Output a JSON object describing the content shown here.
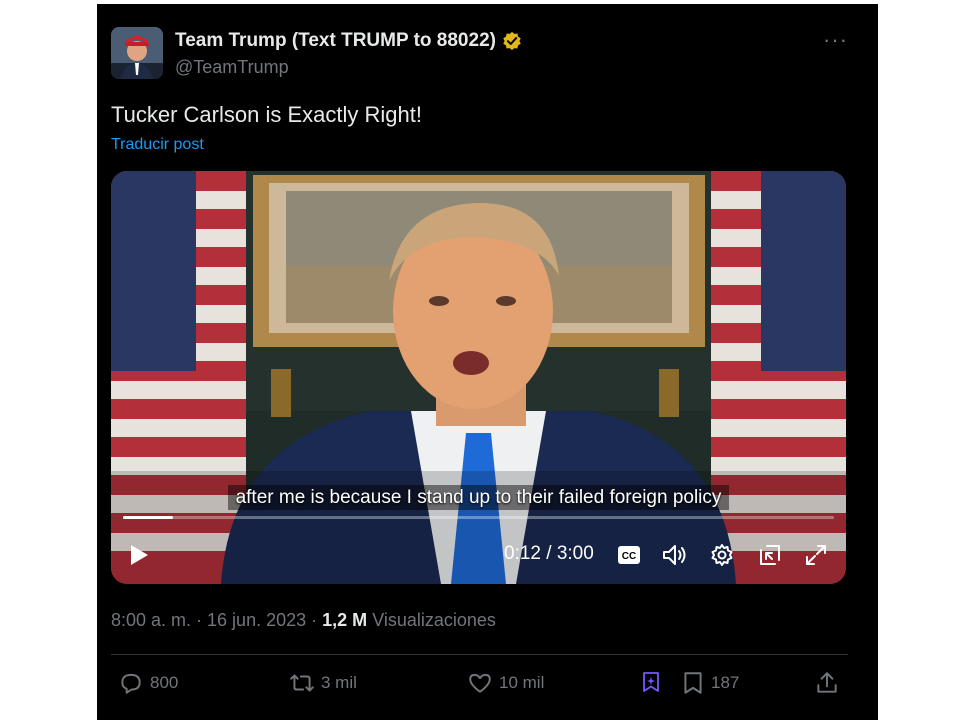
{
  "post": {
    "author_name": "Team Trump (Text TRUMP to 88022)",
    "handle": "@TeamTrump",
    "more_glyph": "···",
    "text": "Tucker Carlson is Exactly Right!",
    "translate_label": "Traducir post"
  },
  "video": {
    "caption": "after me is because I stand up to their failed foreign policy",
    "progress": 0.07,
    "time": "0:12 / 3:00"
  },
  "meta": {
    "timestamp": "8:00 a. m. · 16 jun. 2023 ·",
    "views_count": "1,2 M",
    "views_label": "Visualizaciones"
  },
  "actions": {
    "replies": "800",
    "reposts": "3 mil",
    "likes": "10 mil",
    "bookmarks": "187"
  },
  "icons": [
    "verified-badge-icon",
    "more-icon",
    "play-icon",
    "cc-icon",
    "volume-icon",
    "settings-icon",
    "pip-icon",
    "fullscreen-icon",
    "reply-icon",
    "repost-icon",
    "like-icon",
    "grok-icon",
    "bookmark-icon",
    "share-icon"
  ],
  "colors": {
    "background": "#000000",
    "text": "#e7e9ea",
    "secondary": "#71767b",
    "link": "#1d9bf0",
    "verified": "#e2b719",
    "grok": "#7856ff"
  }
}
